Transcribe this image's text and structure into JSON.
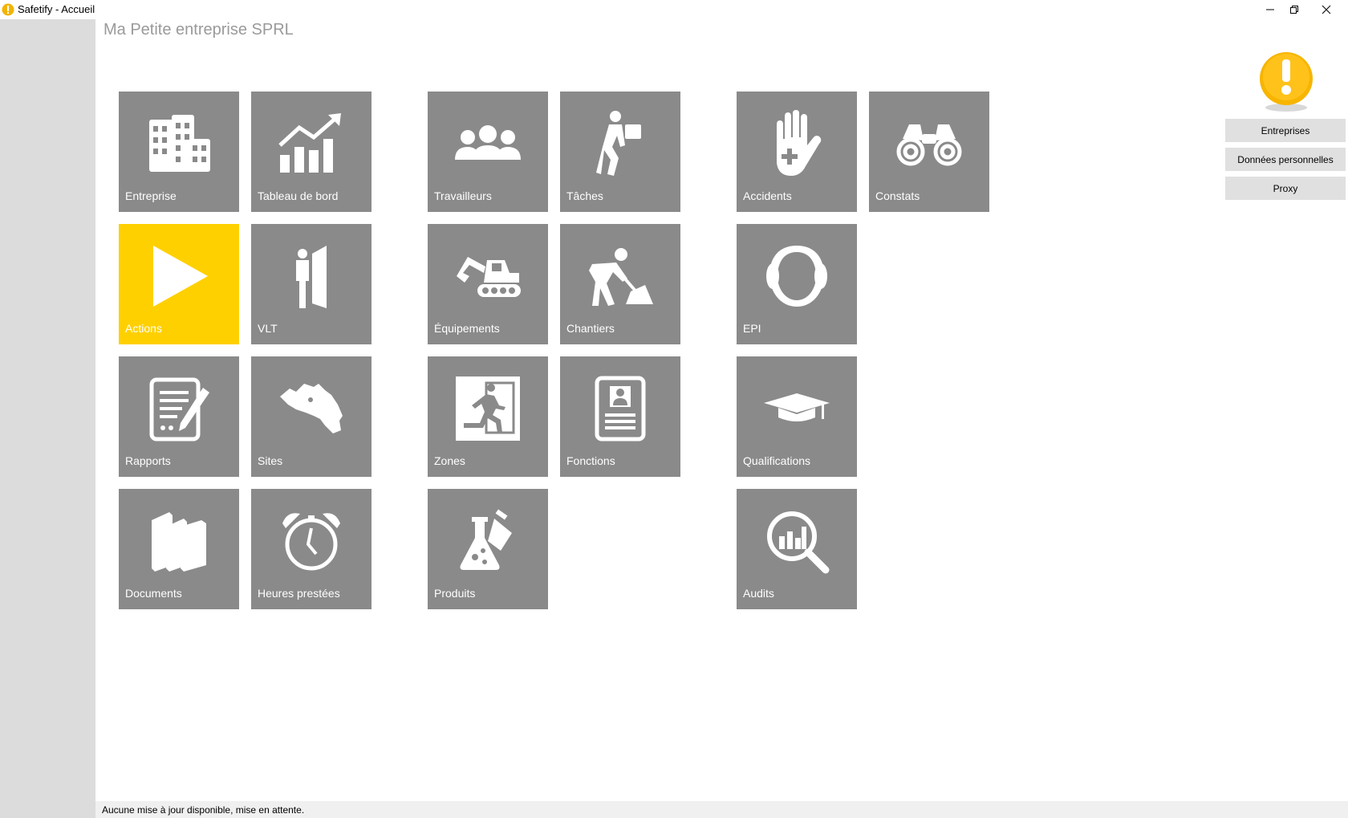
{
  "window": {
    "title": "Safetify - Accueil"
  },
  "header": {
    "company_name": "Ma Petite entreprise SPRL"
  },
  "tiles": [
    {
      "label": "Entreprise",
      "icon": "buildings-icon",
      "active": false
    },
    {
      "label": "Tableau de bord",
      "icon": "chart-growth-icon",
      "active": false
    },
    {
      "label": "Travailleurs",
      "icon": "people-icon",
      "active": false
    },
    {
      "label": "Tâches",
      "icon": "worker-carrying-icon",
      "active": false
    },
    {
      "label": "Accidents",
      "icon": "hand-medical-icon",
      "active": false
    },
    {
      "label": "Constats",
      "icon": "binoculars-icon",
      "active": false
    },
    {
      "label": "Actions",
      "icon": "play-icon",
      "active": true
    },
    {
      "label": "VLT",
      "icon": "person-door-icon",
      "active": false
    },
    {
      "label": "Équipements",
      "icon": "excavator-icon",
      "active": false
    },
    {
      "label": "Chantiers",
      "icon": "digging-worker-icon",
      "active": false
    },
    {
      "label": "EPI",
      "icon": "ear-protection-icon",
      "active": false
    },
    {
      "label": "Rapports",
      "icon": "report-pen-icon",
      "active": false
    },
    {
      "label": "Sites",
      "icon": "belgium-map-icon",
      "active": false
    },
    {
      "label": "Zones",
      "icon": "emergency-exit-icon",
      "active": false
    },
    {
      "label": "Fonctions",
      "icon": "id-card-icon",
      "active": false
    },
    {
      "label": "Qualifications",
      "icon": "graduation-cap-icon",
      "active": false
    },
    {
      "label": "Documents",
      "icon": "books-icon",
      "active": false
    },
    {
      "label": "Heures prestées",
      "icon": "alarm-clock-icon",
      "active": false
    },
    {
      "label": "Produits",
      "icon": "chemical-flask-icon",
      "active": false
    },
    {
      "label": "Audits",
      "icon": "magnifier-chart-icon",
      "active": false
    }
  ],
  "side_panel": {
    "warning_icon": "exclamation-warning-icon",
    "buttons": [
      "Entreprises",
      "Données personnelles",
      "Proxy"
    ]
  },
  "status_bar": {
    "text": "Aucune mise à jour disponible, mise en attente."
  },
  "colors": {
    "tile": "#8a8a8a",
    "active_tile": "#ffd000",
    "sidebar": "#dcdcdc"
  }
}
